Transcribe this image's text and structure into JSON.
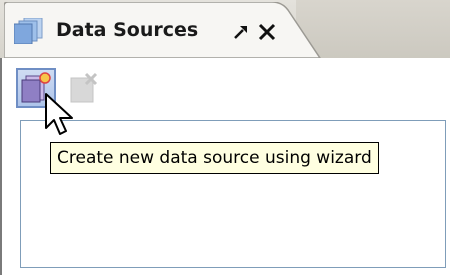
{
  "panel": {
    "tab_title": "Data Sources",
    "tab_icon": "database-icon",
    "pin_icon": "pin-icon",
    "close_icon": "close-icon"
  },
  "toolbar": {
    "new_button_icon": "new-data-source-icon",
    "delete_button_icon": "delete-data-source-icon",
    "new_button_state": "hovered",
    "delete_button_state": "disabled"
  },
  "tooltip": {
    "text": "Create new data source using wizard"
  },
  "colors": {
    "tooltip_bg": "#ffffe1",
    "hover_blue": "#aec4ea",
    "border_blue": "#7f9db9"
  }
}
